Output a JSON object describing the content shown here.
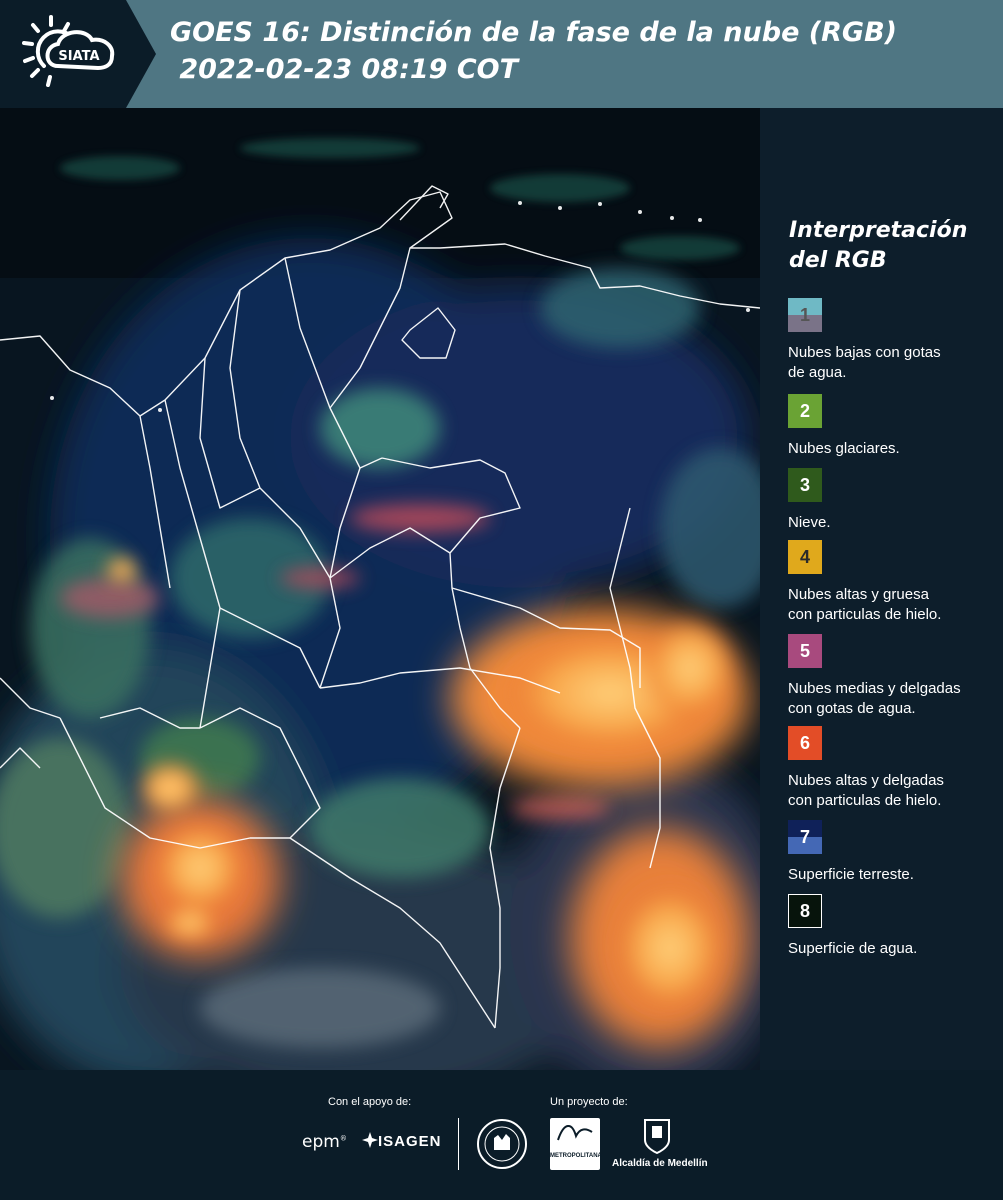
{
  "header": {
    "logo_text": "SIATA",
    "title_line1": "GOES 16: Distinción de la fase de la nube (RGB)",
    "title_line2": " 2022-02-23 08:19 COT"
  },
  "legend": {
    "title": "Interpretación\ndel RGB",
    "items": [
      {
        "number": "1",
        "label": "Nubes bajas con gotas\nde agua.",
        "colors": [
          "#6fb9c5",
          "#7a7388"
        ]
      },
      {
        "number": "2",
        "label": "Nubes glaciares.",
        "colors": [
          "#6aa334"
        ]
      },
      {
        "number": "3",
        "label": "Nieve.",
        "colors": [
          "#2f5a1c"
        ]
      },
      {
        "number": "4",
        "label": "Nubes altas y gruesa\ncon particulas de hielo.",
        "colors": [
          "#e0a91c"
        ]
      },
      {
        "number": "5",
        "label": "Nubes medias y delgadas\ncon gotas de agua.",
        "colors": [
          "#a84a7e"
        ]
      },
      {
        "number": "6",
        "label": "Nubes altas y delgadas\ncon particulas de hielo.",
        "colors": [
          "#e34d27"
        ]
      },
      {
        "number": "7",
        "label": "Superficie terreste.",
        "colors": [
          "#0f2159",
          "#4468b5"
        ]
      },
      {
        "number": "8",
        "label": "Superficie de agua.",
        "colors": [
          "#07140c"
        ]
      }
    ]
  },
  "footer": {
    "support_label": "Con el apoyo de:",
    "project_label": "Un proyecto de:",
    "partners": [
      "epm",
      "ISAGEN"
    ],
    "project_partners": [
      "METROPOLITANA",
      "Alcaldía de Medellín"
    ]
  }
}
